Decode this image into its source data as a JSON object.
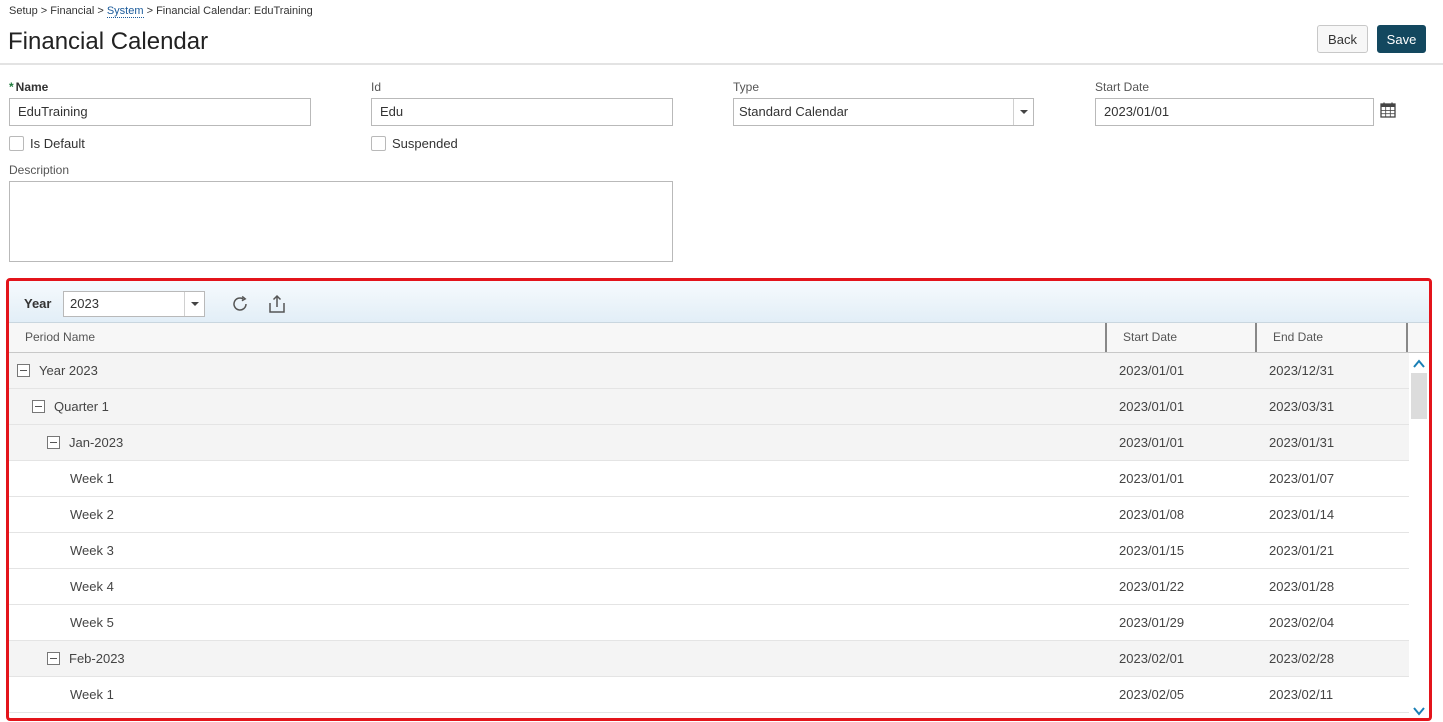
{
  "breadcrumb": {
    "part1": "Setup > Financial > ",
    "link": "System",
    "part2": " > Financial Calendar: EduTraining"
  },
  "page": {
    "title": "Financial Calendar"
  },
  "actions": {
    "back": "Back",
    "save": "Save"
  },
  "form": {
    "name_label": "Name",
    "name_value": "EduTraining",
    "id_label": "Id",
    "id_value": "Edu",
    "type_label": "Type",
    "type_value": "Standard Calendar",
    "start_date_label": "Start Date",
    "start_date_value": "2023/01/01",
    "is_default_label": "Is Default",
    "suspended_label": "Suspended",
    "description_label": "Description",
    "description_value": ""
  },
  "grid": {
    "year_label": "Year",
    "year_value": "2023",
    "columns": {
      "name": "Period Name",
      "start": "Start Date",
      "end": "End Date"
    },
    "rows": [
      {
        "name": "Year 2023",
        "start": "2023/01/01",
        "end": "2023/12/31",
        "level": 0,
        "expandable": true
      },
      {
        "name": "Quarter 1",
        "start": "2023/01/01",
        "end": "2023/03/31",
        "level": 1,
        "expandable": true
      },
      {
        "name": "Jan-2023",
        "start": "2023/01/01",
        "end": "2023/01/31",
        "level": 2,
        "expandable": true
      },
      {
        "name": "Week 1",
        "start": "2023/01/01",
        "end": "2023/01/07",
        "level": 3,
        "expandable": false
      },
      {
        "name": "Week 2",
        "start": "2023/01/08",
        "end": "2023/01/14",
        "level": 3,
        "expandable": false
      },
      {
        "name": "Week 3",
        "start": "2023/01/15",
        "end": "2023/01/21",
        "level": 3,
        "expandable": false
      },
      {
        "name": "Week 4",
        "start": "2023/01/22",
        "end": "2023/01/28",
        "level": 3,
        "expandable": false
      },
      {
        "name": "Week 5",
        "start": "2023/01/29",
        "end": "2023/02/04",
        "level": 3,
        "expandable": false
      },
      {
        "name": "Feb-2023",
        "start": "2023/02/01",
        "end": "2023/02/28",
        "level": 2,
        "expandable": true
      },
      {
        "name": "Week 1",
        "start": "2023/02/05",
        "end": "2023/02/11",
        "level": 3,
        "expandable": false
      }
    ]
  },
  "icons": {
    "calendar": "calendar-icon",
    "refresh": "refresh-icon",
    "export": "export-icon",
    "collapse": "minus-square-icon",
    "scroll_up": "chevron-up-icon",
    "scroll_down": "chevron-down-icon"
  },
  "colors": {
    "save_button": "#13485f",
    "highlight_frame": "#e3141b",
    "required_star": "#1e7a3c"
  }
}
